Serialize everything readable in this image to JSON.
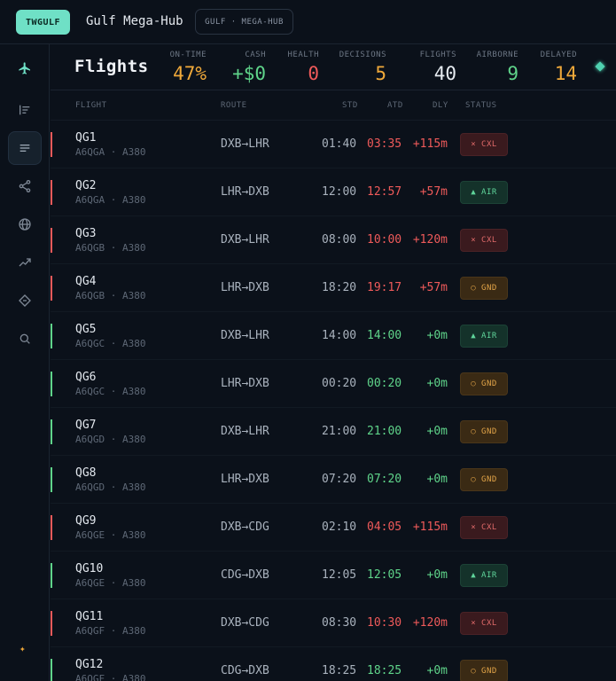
{
  "topbar": {
    "logo": "TWGULF",
    "title": "Gulf Mega-Hub",
    "hub_pill": "GULF · MEGA-HUB"
  },
  "sidebar": {
    "items": [
      "plane-icon",
      "timeline-icon",
      "list-icon",
      "network-icon",
      "globe-icon",
      "trend-icon",
      "ticket-icon",
      "search-icon"
    ],
    "active_index": 2
  },
  "header": {
    "title": "Flights",
    "stats": [
      {
        "label": "ON-TIME",
        "value": "47%",
        "color": "#f0a93a"
      },
      {
        "label": "CASH",
        "value": "+$0",
        "color": "#5fd48a"
      },
      {
        "label": "HEALTH",
        "value": "0",
        "color": "#ef5a5a"
      },
      {
        "label": "DECISIONS",
        "value": "5",
        "color": "#f0a93a"
      },
      {
        "label": "FLIGHTS",
        "value": "40",
        "color": "#e6ebf0"
      },
      {
        "label": "AIRBORNE",
        "value": "9",
        "color": "#5fd48a"
      },
      {
        "label": "DELAYED",
        "value": "14",
        "color": "#f0a93a"
      }
    ]
  },
  "table": {
    "columns": {
      "flight": "FLIGHT",
      "route": "ROUTE",
      "std": "STD",
      "atd": "ATD",
      "dly": "DLY",
      "status": "STATUS"
    },
    "rows": [
      {
        "flight": "QG1",
        "reg": "A6QGA · A380",
        "route": "DXB→LHR",
        "std": "01:40",
        "atd": "03:35",
        "dly": "+115m",
        "late": true,
        "status": "× CXL",
        "kind": "cxl"
      },
      {
        "flight": "QG2",
        "reg": "A6QGA · A380",
        "route": "LHR→DXB",
        "std": "12:00",
        "atd": "12:57",
        "dly": "+57m",
        "late": true,
        "status": "▲ AIR",
        "kind": "air"
      },
      {
        "flight": "QG3",
        "reg": "A6QGB · A380",
        "route": "DXB→LHR",
        "std": "08:00",
        "atd": "10:00",
        "dly": "+120m",
        "late": true,
        "status": "× CXL",
        "kind": "cxl"
      },
      {
        "flight": "QG4",
        "reg": "A6QGB · A380",
        "route": "LHR→DXB",
        "std": "18:20",
        "atd": "19:17",
        "dly": "+57m",
        "late": true,
        "status": "○ GND",
        "kind": "gnd"
      },
      {
        "flight": "QG5",
        "reg": "A6QGC · A380",
        "route": "DXB→LHR",
        "std": "14:00",
        "atd": "14:00",
        "dly": "+0m",
        "late": false,
        "status": "▲ AIR",
        "kind": "air"
      },
      {
        "flight": "QG6",
        "reg": "A6QGC · A380",
        "route": "LHR→DXB",
        "std": "00:20",
        "atd": "00:20",
        "dly": "+0m",
        "late": false,
        "status": "○ GND",
        "kind": "gnd"
      },
      {
        "flight": "QG7",
        "reg": "A6QGD · A380",
        "route": "DXB→LHR",
        "std": "21:00",
        "atd": "21:00",
        "dly": "+0m",
        "late": false,
        "status": "○ GND",
        "kind": "gnd"
      },
      {
        "flight": "QG8",
        "reg": "A6QGD · A380",
        "route": "LHR→DXB",
        "std": "07:20",
        "atd": "07:20",
        "dly": "+0m",
        "late": false,
        "status": "○ GND",
        "kind": "gnd"
      },
      {
        "flight": "QG9",
        "reg": "A6QGE · A380",
        "route": "DXB→CDG",
        "std": "02:10",
        "atd": "04:05",
        "dly": "+115m",
        "late": true,
        "status": "× CXL",
        "kind": "cxl"
      },
      {
        "flight": "QG10",
        "reg": "A6QGE · A380",
        "route": "CDG→DXB",
        "std": "12:05",
        "atd": "12:05",
        "dly": "+0m",
        "late": false,
        "status": "▲ AIR",
        "kind": "air"
      },
      {
        "flight": "QG11",
        "reg": "A6QGF · A380",
        "route": "DXB→CDG",
        "std": "08:30",
        "atd": "10:30",
        "dly": "+120m",
        "late": true,
        "status": "× CXL",
        "kind": "cxl"
      },
      {
        "flight": "QG12",
        "reg": "A6QGF · A380",
        "route": "CDG→DXB",
        "std": "18:25",
        "atd": "18:25",
        "dly": "+0m",
        "late": false,
        "status": "○ GND",
        "kind": "gnd"
      }
    ]
  },
  "colors": {
    "accent": "#6fe0c6",
    "late": "#ef5a5a",
    "ontime": "#5fd48a",
    "warn": "#f0a93a"
  }
}
